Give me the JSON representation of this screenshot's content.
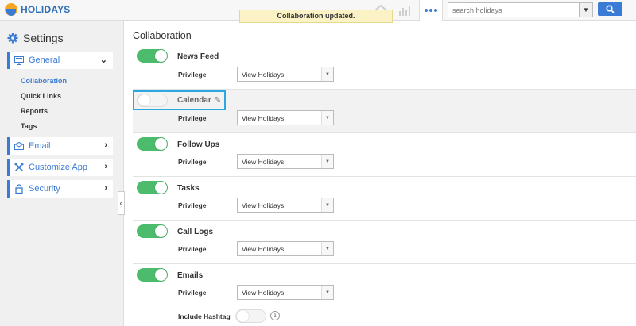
{
  "app": {
    "name": "HOLIDAYS"
  },
  "toast": {
    "message": "Collaboration updated."
  },
  "search": {
    "placeholder": "search holidays"
  },
  "sidebar": {
    "title": "Settings",
    "general": {
      "label": "General"
    },
    "sub_items": [
      "Collaboration",
      "Quick Links",
      "Reports",
      "Tags"
    ],
    "email": {
      "label": "Email"
    },
    "customize": {
      "label": "Customize App"
    },
    "security": {
      "label": "Security"
    }
  },
  "main": {
    "title": "Collaboration",
    "privilege_label": "Privilege",
    "rows": [
      {
        "label": "News Feed",
        "enabled": true,
        "privilege": "View Holidays"
      },
      {
        "label": "Calendar",
        "enabled": false,
        "privilege": "View Holidays"
      },
      {
        "label": "Follow Ups",
        "enabled": true,
        "privilege": "View Holidays"
      },
      {
        "label": "Tasks",
        "enabled": true,
        "privilege": "View Holidays"
      },
      {
        "label": "Call Logs",
        "enabled": true,
        "privilege": "View Holidays"
      },
      {
        "label": "Emails",
        "enabled": true,
        "privilege": "View Holidays"
      }
    ],
    "include_hashtag": {
      "label": "Include Hashtag",
      "enabled": false
    }
  },
  "colors": {
    "accent": "#3a7bd5",
    "toggle_on": "#4cbb6c",
    "focus": "#29a9e0"
  }
}
